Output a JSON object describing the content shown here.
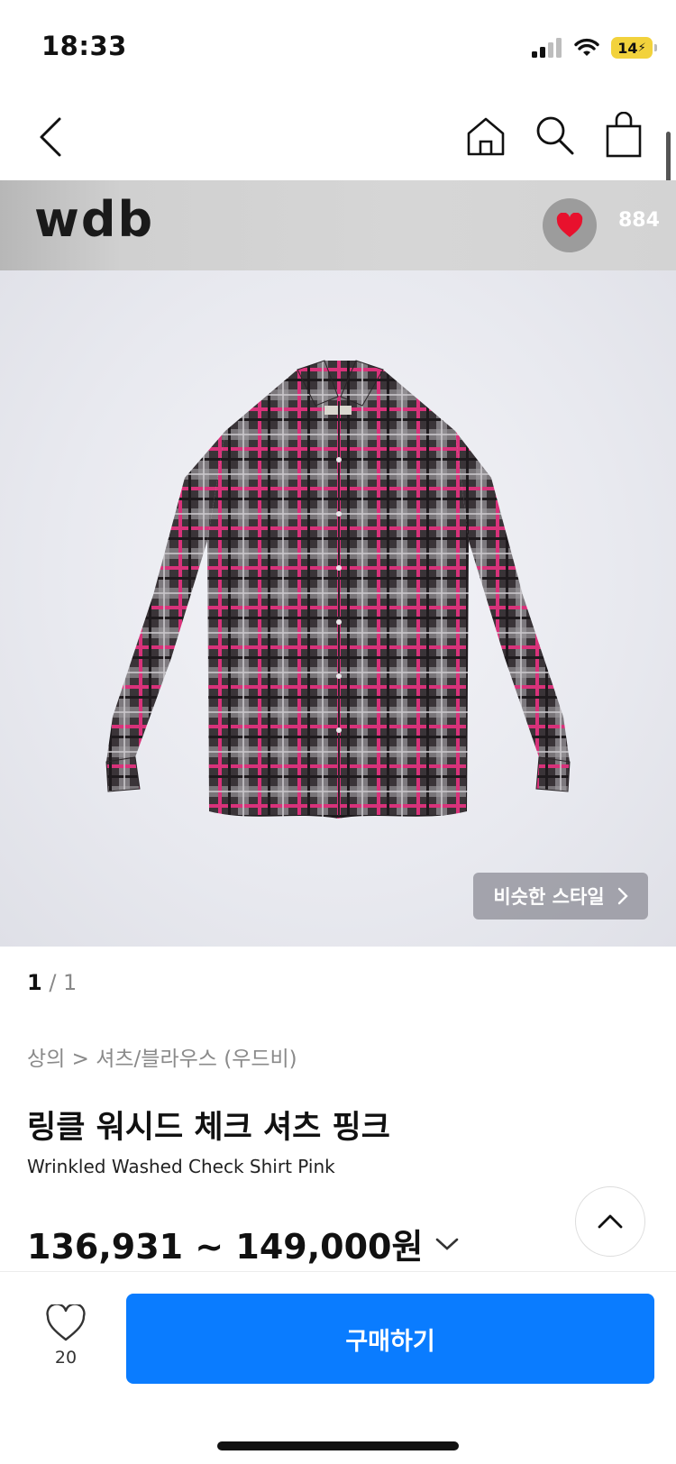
{
  "status_bar": {
    "time": "18:33",
    "battery": "14"
  },
  "nav": {
    "icons": [
      "back-icon",
      "home-icon",
      "search-icon",
      "cart-icon"
    ]
  },
  "brand": {
    "logo_text": "wdb",
    "like_count": "884"
  },
  "product_image": {
    "similar_style_label": "비슷한 스타일"
  },
  "pager": {
    "current": "1",
    "total": "/ 1"
  },
  "breadcrumb": "상의 > 셔츠/블라우스 (우드비)",
  "product": {
    "title_ko": "링클 워시드 체크 셔츠 핑크",
    "title_en": "Wrinkled Washed Check Shirt Pink",
    "price_range": "136,931 ~ 149,000원"
  },
  "bottom_bar": {
    "wish_count": "20",
    "buy_label": "구매하기"
  },
  "colors": {
    "accent": "#0a7cff",
    "heart": "#e8112d",
    "battery": "#f2d23c"
  }
}
